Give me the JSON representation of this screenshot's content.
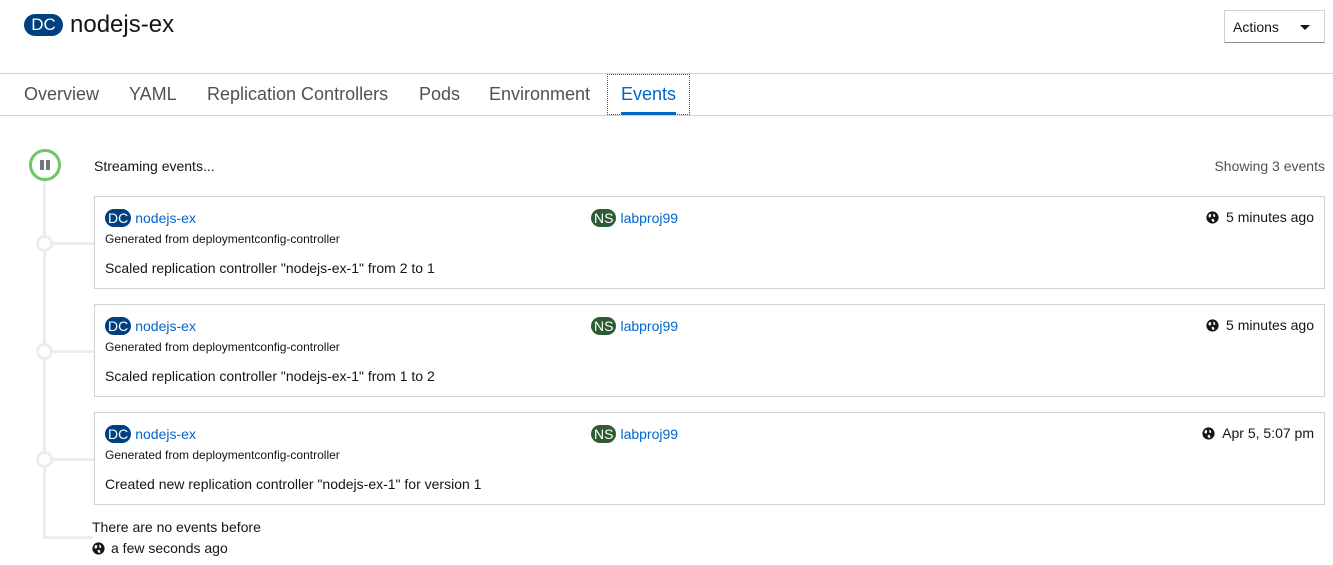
{
  "header": {
    "kind_badge": "DC",
    "title": "nodejs-ex",
    "actions_label": "Actions"
  },
  "tabs": [
    {
      "label": "Overview",
      "active": false
    },
    {
      "label": "YAML",
      "active": false
    },
    {
      "label": "Replication Controllers",
      "active": false
    },
    {
      "label": "Pods",
      "active": false
    },
    {
      "label": "Environment",
      "active": false
    },
    {
      "label": "Events",
      "active": true
    }
  ],
  "stream": {
    "status": "Streaming events...",
    "count": "Showing 3 events"
  },
  "events": [
    {
      "kind_badge": "DC",
      "name": "nodejs-ex",
      "ns_badge": "NS",
      "namespace": "labproj99",
      "time": "5 minutes ago",
      "source": "Generated from deploymentconfig-controller",
      "message": "Scaled replication controller \"nodejs-ex-1\" from 2 to 1"
    },
    {
      "kind_badge": "DC",
      "name": "nodejs-ex",
      "ns_badge": "NS",
      "namespace": "labproj99",
      "time": "5 minutes ago",
      "source": "Generated from deploymentconfig-controller",
      "message": "Scaled replication controller \"nodejs-ex-1\" from 1 to 2"
    },
    {
      "kind_badge": "DC",
      "name": "nodejs-ex",
      "ns_badge": "NS",
      "namespace": "labproj99",
      "time": "Apr 5, 5:07 pm",
      "source": "Generated from deploymentconfig-controller",
      "message": "Created new replication controller \"nodejs-ex-1\" for version 1"
    }
  ],
  "footer": {
    "no_events": "There are no events before",
    "no_events_time": "a few seconds ago"
  },
  "colors": {
    "accent": "#0066cc",
    "dc_badge": "#004080",
    "ns_badge": "#2d5c33",
    "stream_ring": "#6ec664"
  },
  "icons": {
    "time": "globe-icon",
    "pause": "pause-icon",
    "dropdown": "caret-down-icon"
  }
}
